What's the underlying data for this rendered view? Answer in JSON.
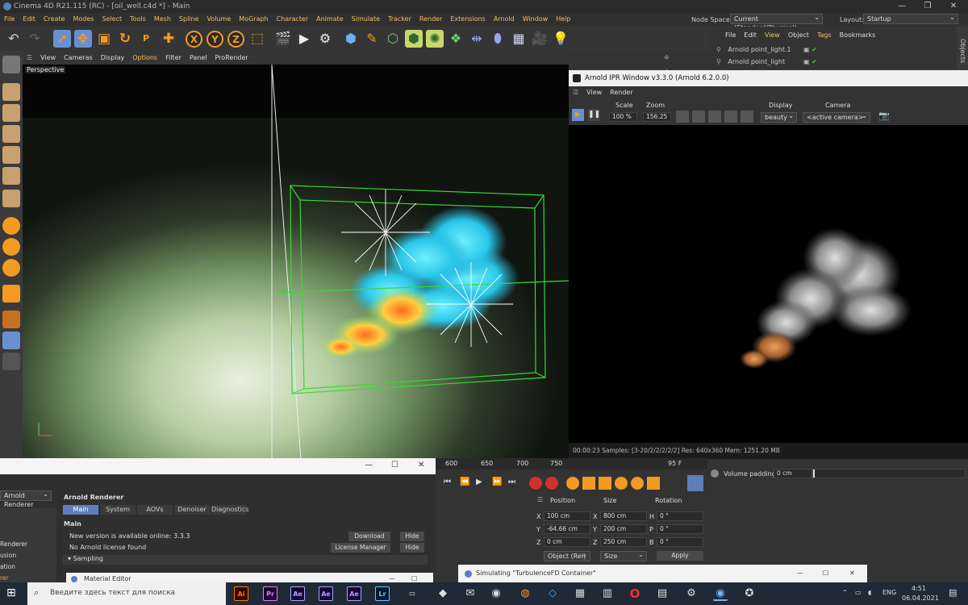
{
  "window": {
    "title": "Cinema 4D R21.115 (RC) - [oil_well.c4d *] - Main"
  },
  "menubar": {
    "items": [
      "File",
      "Edit",
      "Create",
      "Modes",
      "Select",
      "Tools",
      "Mesh",
      "Spline",
      "Volume",
      "MoGraph",
      "Character",
      "Animate",
      "Simulate",
      "Tracker",
      "Render",
      "Extensions",
      "Arnold",
      "Window",
      "Help"
    ],
    "node_space_label": "Node Space:",
    "node_space_value": "Current (Standard/Physical)",
    "layout_label": "Layout:",
    "layout_value": "Startup"
  },
  "toolbar": {
    "xyz": [
      "X",
      "Y",
      "Z"
    ]
  },
  "object_manager": {
    "menu": [
      "File",
      "Edit",
      "View",
      "Object",
      "Tags",
      "Bookmarks"
    ],
    "rows": [
      "Arnold point_light.1",
      "Arnold point_light"
    ],
    "side_tab": "Objects"
  },
  "viewport": {
    "menu": [
      "View",
      "Cameras",
      "Display",
      "Options",
      "Filter",
      "Panel",
      "ProRender"
    ],
    "label": "Perspective"
  },
  "ipr": {
    "title": "Arnold IPR Window v3.3.0 (Arnold 6.2.0.0)",
    "menu": [
      "View",
      "Render"
    ],
    "scale_label": "Scale",
    "scale_value": "100 %",
    "zoom_label": "Zoom",
    "zoom_value": "156.25",
    "display_label": "Display",
    "display_value": "beauty",
    "camera_label": "Camera",
    "camera_value": "<active camera>",
    "status": "00:00:23  Samples: [3-20/2/2/2/2/2]  Res: 640x360  Mem: 1251.20 MB"
  },
  "render_settings": {
    "renderer": "Arnold Renderer",
    "header": "Arnold Renderer",
    "tabs": [
      "Main",
      "System",
      "AOVs",
      "Denoiser",
      "Diagnostics"
    ],
    "section": "Main",
    "new_version_text": "New version is available online: 3.3.3",
    "license_text": "No Arnold license found",
    "download_btn": "Download",
    "hide_btn": "Hide",
    "license_btn": "License Manager",
    "sampling": "Sampling",
    "side_items": [
      "Renderer",
      "usion",
      "ation",
      "rer"
    ]
  },
  "timeline": {
    "ticks": [
      "600",
      "650",
      "700",
      "750"
    ],
    "frame": "95 F"
  },
  "coordinates": {
    "headers": [
      "Position",
      "Size",
      "Rotation"
    ],
    "rows": [
      {
        "axis": "X",
        "pos": "100 cm",
        "saxis": "X",
        "size": "800 cm",
        "raxis": "H",
        "rot": "0 °"
      },
      {
        "axis": "Y",
        "pos": "-64.66 cm",
        "saxis": "Y",
        "size": "200 cm",
        "raxis": "P",
        "rot": "0 °"
      },
      {
        "axis": "Z",
        "pos": "0 cm",
        "saxis": "Z",
        "size": "250 cm",
        "raxis": "B",
        "rot": "0 °"
      }
    ],
    "mode": "Object (Rel)",
    "size_mode": "Size",
    "apply": "Apply"
  },
  "attributes": {
    "label": "Volume padding",
    "value": "0 cm"
  },
  "material_editor": {
    "title": "Material Editor"
  },
  "simulating": {
    "title": "Simulating \"TurbulenceFD Container\""
  },
  "taskbar": {
    "search_placeholder": "Введите здесь текст для поиска",
    "apps": [
      "Ai",
      "Pr",
      "Ae",
      "Ae",
      "Ae",
      "Lr"
    ],
    "lang": "ENG",
    "time": "4:51",
    "date": "06.04.2021"
  },
  "colors": {
    "accent_orange": "#f39a22",
    "tool_blue": "#6a8fd0",
    "active_tab": "#5d7fb8",
    "taskbar": "#1f2a36"
  }
}
